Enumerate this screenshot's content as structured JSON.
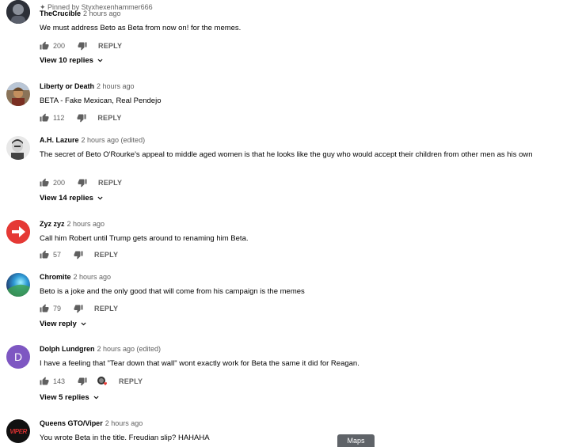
{
  "comments": [
    {
      "pinned": "Pinned by Styxhexenhammer666",
      "author": "TheCrucible",
      "time": "2 hours ago",
      "text": "We must address Beto as Beta from now on! for the memes.",
      "likes": "200",
      "reply": "REPLY",
      "view_replies": "View 10 replies"
    },
    {
      "author": "Liberty or Death",
      "time": "2 hours ago",
      "text": "BETA - Fake Mexican, Real Pendejo",
      "likes": "112",
      "reply": "REPLY"
    },
    {
      "author": "A.H. Lazure",
      "time": "2 hours ago (edited)",
      "text": "The secret of Beto O'Rourke's appeal to middle aged women is that he looks like the guy who would accept their children from other men as his own",
      "likes": "200",
      "reply": "REPLY",
      "view_replies": "View 14 replies"
    },
    {
      "author": "Zyz zyz",
      "time": "2 hours ago",
      "text": "Call him Robert until Trump gets around to renaming him Beta.",
      "likes": "57",
      "reply": "REPLY"
    },
    {
      "author": "Chromite",
      "time": "2 hours ago",
      "text": "Beto is a joke and the only good that will come from his campaign is the memes",
      "likes": "79",
      "reply": "REPLY",
      "view_replies": "View reply"
    },
    {
      "author": "Dolph Lundgren",
      "time": "2 hours ago (edited)",
      "avatar_letter": "D",
      "text": "I have a feeling that \"Tear down that wall\" wont exactly work for Beta the same it did for Reagan.",
      "likes": "143",
      "reply": "REPLY",
      "view_replies": "View 5 replies"
    },
    {
      "author": "Queens GTO/Viper",
      "time": "2 hours ago",
      "avatar_text": "VIPER",
      "text": "You wrote Beta in the title. Freudian slip? HAHAHA"
    }
  ],
  "maps_tooltip": "Maps",
  "colors": {
    "author": "#030303",
    "meta": "#606060",
    "avatar_d": "#7e57c2",
    "red_arrow": "#e53935",
    "tooltip_bg": "#5f6368"
  },
  "icons": [
    "thumb-up-icon",
    "thumb-down-icon",
    "chevron-down-icon",
    "creator-heart-icon",
    "pin-icon"
  ]
}
